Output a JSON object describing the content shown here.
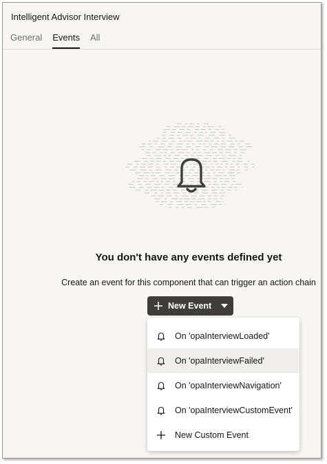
{
  "header": {
    "title": "Intelligent Advisor Interview",
    "tabs": [
      {
        "label": "General",
        "active": false
      },
      {
        "label": "Events",
        "active": true
      },
      {
        "label": "All",
        "active": false
      }
    ]
  },
  "empty_state": {
    "illustration_icon": "bell-icon",
    "title": "You don't have any events defined yet",
    "description": "Create an event for this component that can trigger an action chain"
  },
  "new_event_button": {
    "label": "New Event",
    "icon": "plus-icon",
    "dropdown_icon": "caret-down-icon"
  },
  "menu": {
    "items": [
      {
        "label": "On 'opaInterviewLoaded'",
        "icon": "bell-icon"
      },
      {
        "label": "On 'opaInterviewFailed'",
        "icon": "bell-icon",
        "hovered": true
      },
      {
        "label": "On 'opaInterviewNavigation'",
        "icon": "bell-icon"
      },
      {
        "label": "On 'opaInterviewCustomEvent'",
        "icon": "bell-icon"
      },
      {
        "label": "New Custom Event",
        "icon": "plus-icon"
      }
    ]
  },
  "colors": {
    "panel_background": "#f7f6f5",
    "button_background": "#3f3d3a",
    "text": "#161513",
    "muted_text": "#6f6c68",
    "hover_background": "#f1efed"
  }
}
